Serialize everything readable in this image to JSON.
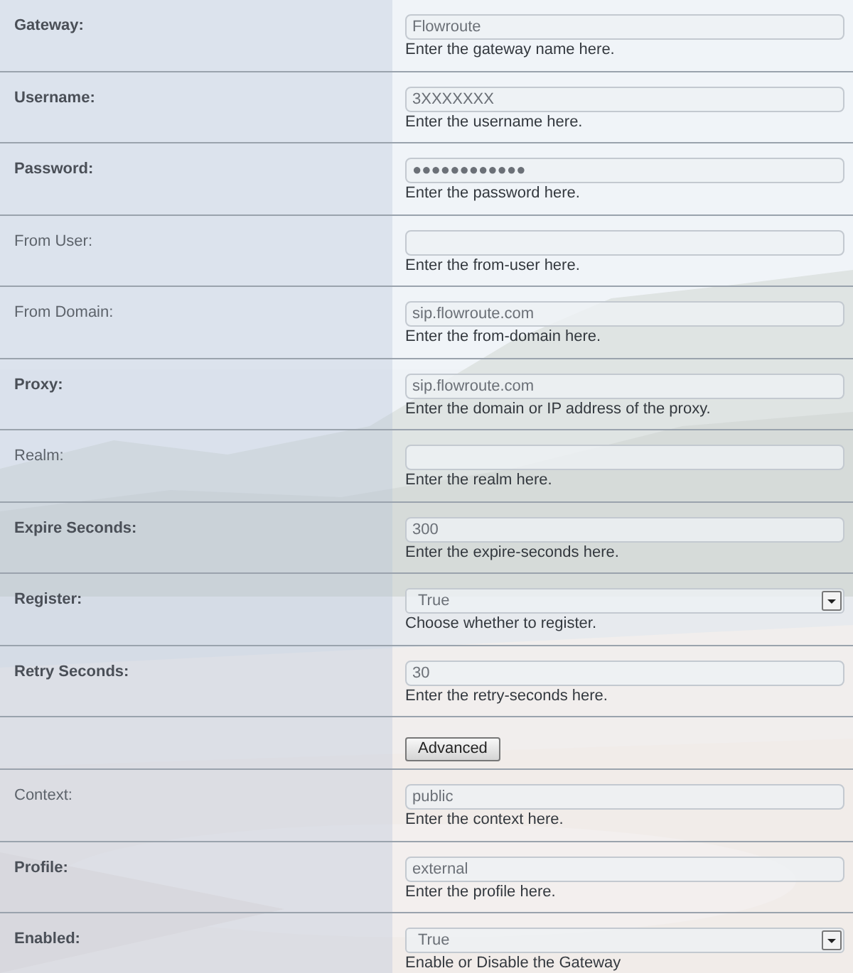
{
  "rows": [
    {
      "label": "Gateway:",
      "required": true,
      "kind": "text",
      "value": "Flowroute",
      "help": "Enter the gateway name here."
    },
    {
      "label": "Username:",
      "required": true,
      "kind": "text",
      "value": "3XXXXXXX",
      "help": "Enter the username here."
    },
    {
      "label": "Password:",
      "required": true,
      "kind": "text",
      "value": "●●●●●●●●●●●●",
      "help": "Enter the password here."
    },
    {
      "label": "From User:",
      "required": false,
      "kind": "text",
      "help": "Enter the from-user here."
    },
    {
      "label": "From Domain:",
      "required": false,
      "kind": "text",
      "value": "sip.flowroute.com",
      "help": "Enter the from-domain here."
    },
    {
      "label": "Proxy:",
      "required": true,
      "kind": "text",
      "value": "sip.flowroute.com",
      "help": "Enter the domain or IP address of the proxy."
    },
    {
      "label": "Realm:",
      "required": false,
      "kind": "text",
      "help": "Enter the realm here."
    },
    {
      "label": "Expire Seconds:",
      "required": true,
      "kind": "text",
      "value": "300",
      "help": "Enter the expire-seconds here."
    },
    {
      "label": "Register:",
      "required": true,
      "kind": "select",
      "value": "True",
      "help": "Choose whether to register."
    },
    {
      "label": "Retry Seconds:",
      "required": true,
      "kind": "text",
      "value": "30",
      "help": "Enter the retry-seconds here."
    },
    {
      "kind": "button",
      "value": "Advanced"
    },
    {
      "label": "Context:",
      "required": false,
      "kind": "text",
      "value": "public",
      "help": "Enter the context here."
    },
    {
      "label": "Profile:",
      "required": true,
      "kind": "text",
      "value": "external",
      "help": "Enter the profile here."
    },
    {
      "label": "Enabled:",
      "required": true,
      "kind": "select",
      "value": "True",
      "help": "Enable or Disable the Gateway"
    }
  ]
}
